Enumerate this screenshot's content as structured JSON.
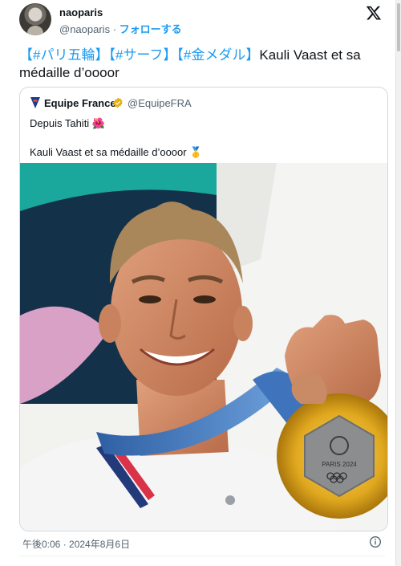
{
  "author": {
    "display_name": "naoparis",
    "handle": "@naoparis",
    "separator": " · ",
    "follow_label": "フォローする"
  },
  "brand": {
    "icon": "x-logo-icon"
  },
  "tweet": {
    "hashtag_1": "【#パリ五輪】",
    "hashtag_2": "【#サーフ】",
    "hashtag_3": "【#金メダル】",
    "body": "Kauli Vaast et sa médaille d’oooor"
  },
  "quote": {
    "display_name": "Equipe France",
    "handle": "@EquipeFRA",
    "text": "Depuis Tahiti 🌺\n\nKauli Vaast et sa médaille d’oooor 🥇",
    "medal_inscription": "PARIS 2024",
    "icons": [
      "team-logo-icon",
      "verified-badge-icon"
    ]
  },
  "meta": {
    "timestamp": "午後0:06 · 2024年8月6日",
    "info_icon": "info-icon"
  },
  "colors": {
    "accent": "#1d9bf0",
    "text": "#0f1419",
    "muted": "#536471",
    "border": "#cfd9de",
    "gold": "#e0a81e"
  }
}
